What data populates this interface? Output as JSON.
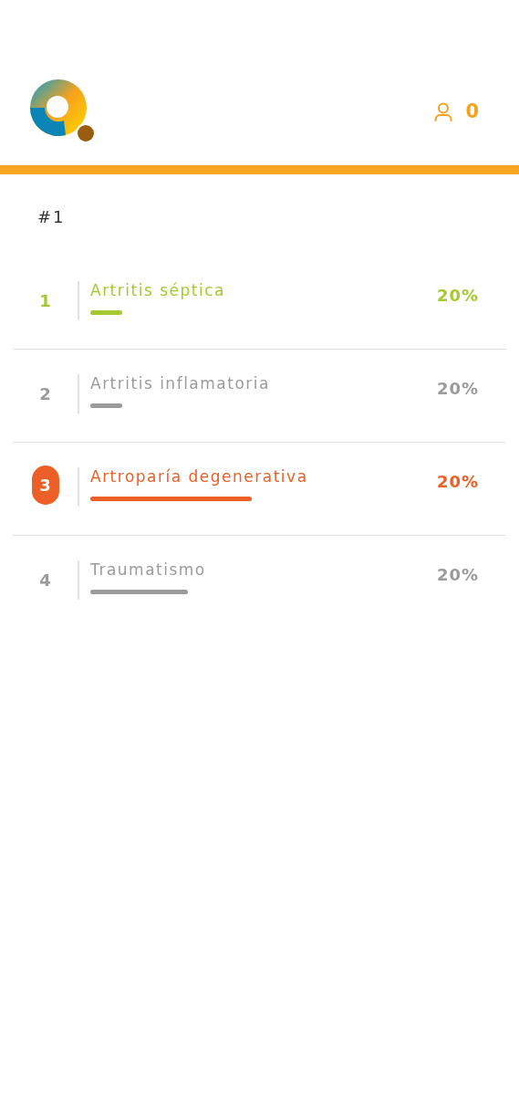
{
  "header": {
    "score": "0"
  },
  "question": {
    "number": "#1"
  },
  "options": [
    {
      "index": "1",
      "label": "Artritis séptica",
      "percent": "20%",
      "color": "#a5c932",
      "selected": false
    },
    {
      "index": "2",
      "label": "Artritis inflamatoria",
      "percent": "20%",
      "color": "#9b9b9b",
      "selected": false
    },
    {
      "index": "3",
      "label": "Artroparía degenerativa",
      "percent": "20%",
      "color": "#ec5f26",
      "selected": true
    },
    {
      "index": "4",
      "label": "Traumatismo",
      "percent": "20%",
      "color": "#9b9b9b",
      "selected": false
    }
  ]
}
